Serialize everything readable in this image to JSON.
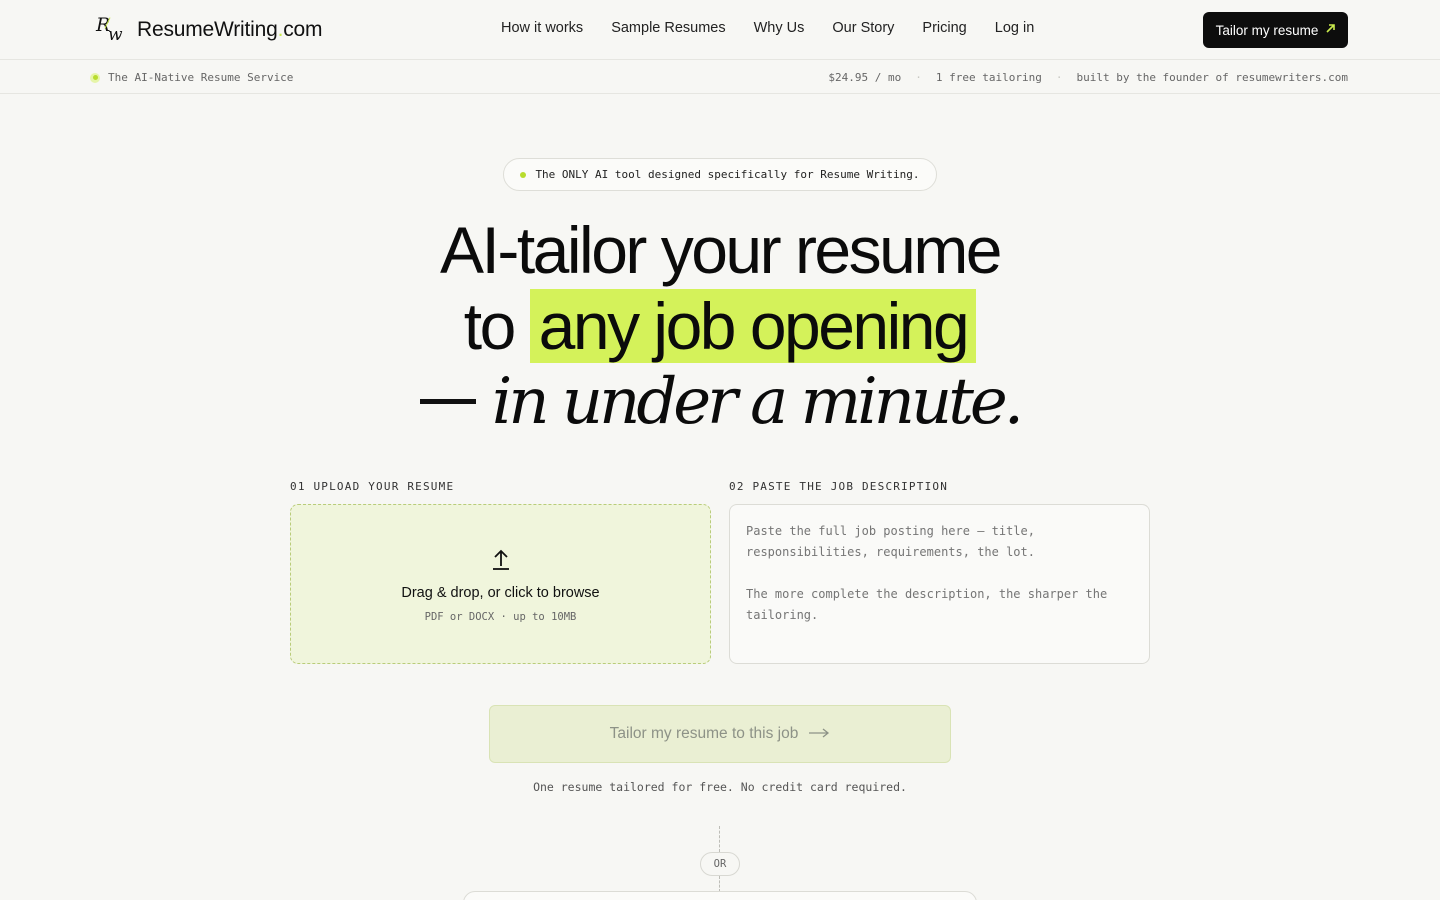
{
  "header": {
    "brand": "ResumeWriting",
    "brand_dot": ".",
    "brand_tld": "com",
    "logo_r": "R",
    "logo_w": "w",
    "nav": [
      "How it works",
      "Sample Resumes",
      "Why Us",
      "Our Story",
      "Pricing",
      "Log in"
    ],
    "cta_label": "Tailor my resume",
    "cta_icon": "arrow-up-right-icon"
  },
  "subbar": {
    "tagline": "The AI-Native Resume Service",
    "price": "$24.95 / mo",
    "free": "1 free tailoring",
    "founder": "built by the founder of resumewriters.com",
    "separator": "·"
  },
  "hero": {
    "pill": "The ONLY AI tool designed specifically for Resume Writing.",
    "line1": "AI-tailor your resume",
    "line2_pre": "to",
    "line2_highlight": "any job opening",
    "line3_italic": "in under a minute."
  },
  "steps": {
    "upload_label": "01 UPLOAD YOUR RESUME",
    "upload_title": "Drag & drop, or click to browse",
    "upload_sub": "PDF or DOCX · up to 10MB",
    "job_label": "02 PASTE THE JOB DESCRIPTION",
    "job_placeholder": "Paste the full job posting here — title, responsibilities, requirements, the lot.\n\nThe more complete the description, the sharper the tailoring."
  },
  "action": {
    "cta_label": "Tailor my resume to this job",
    "cta_arrow": "⟶",
    "note": "One resume tailored for free. No credit card required.",
    "or": "OR"
  },
  "colors": {
    "accent": "#d4f25a",
    "background": "#f7f7f4",
    "dark": "#0d0d0d"
  }
}
